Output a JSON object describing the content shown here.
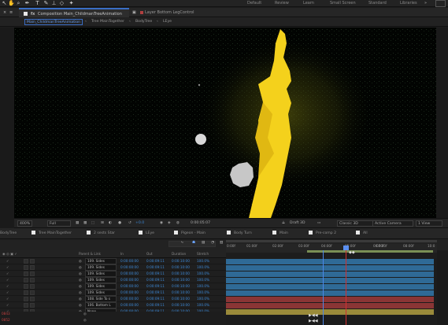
{
  "workspaces": [
    "Default",
    "Review",
    "Learn",
    "Small Screen",
    "Standard",
    "Libraries"
  ],
  "comp_panel": {
    "tab_label": "Composition Main_ChildmanTreeAnimation",
    "layer_tab_label": "Layer Bottom LegControl",
    "breadcrumbs": [
      "Main_ChildmanTreeAnimation",
      "Tree MainTogether",
      "BodyTree",
      "LEye"
    ]
  },
  "viewer_footer": {
    "zoom": "400%",
    "resolution": "Full",
    "exposure": "+0.0",
    "timecode": "0:00:05:07",
    "draft3d": "Draft 3D",
    "renderer": "Classic 3D",
    "camera": "Active Camera",
    "views": "1 View"
  },
  "timeline_tabs": [
    "BodyTree",
    "Tree MainTogether",
    "2 sests Star",
    "LEye",
    "Pigeon - Main",
    "Body Turn",
    "Main",
    "Pre-comp 2",
    "All"
  ],
  "layer_columns": [
    "Parent & Link",
    "In",
    "Out",
    "Duration",
    "Stretch"
  ],
  "ruler_ticks": [
    "0:00f",
    "01:00f",
    "02:00f",
    "03:00f",
    "04:00f",
    "05:00f",
    "06:00f",
    "07:00f",
    "08:00f",
    "09:00f",
    "10:0"
  ],
  "layers": [
    {
      "parent": "109. Sides",
      "in": "0:00:00:00",
      "out": "0:00:09:11",
      "duration": "0:00:10:00",
      "stretch": "100.0%",
      "bar": "#2f6a96"
    },
    {
      "parent": "109. Sides",
      "in": "0:00:00:00",
      "out": "0:00:09:11",
      "duration": "0:00:10:00",
      "stretch": "100.0%",
      "bar": "#2f6a96"
    },
    {
      "parent": "109. Sides",
      "in": "0:00:00:00",
      "out": "0:00:09:11",
      "duration": "0:00:10:00",
      "stretch": "100.0%",
      "bar": "#2f6a96"
    },
    {
      "parent": "109. Sides",
      "in": "0:00:00:00",
      "out": "0:00:09:11",
      "duration": "0:00:10:00",
      "stretch": "100.0%",
      "bar": "#2f6a96"
    },
    {
      "parent": "109. Sides",
      "in": "0:00:00:00",
      "out": "0:00:09:11",
      "duration": "0:00:10:00",
      "stretch": "100.0%",
      "bar": "#2f6a96"
    },
    {
      "parent": "109. Sides",
      "in": "0:00:00:00",
      "out": "0:00:09:11",
      "duration": "0:00:10:00",
      "stretch": "100.0%",
      "bar": "#2f6a96"
    },
    {
      "parent": "108. Side To s",
      "in": "0:00:00:00",
      "out": "0:00:09:11",
      "duration": "0:00:10:00",
      "stretch": "100.0%",
      "bar": "#8a3535"
    },
    {
      "parent": "106. Bottom L",
      "in": "0:00:00:00",
      "out": "0:00:09:11",
      "duration": "0:00:10:00",
      "stretch": "100.0%",
      "bar": "#8a3535"
    },
    {
      "parent": "None",
      "in": "0:00:00:00",
      "out": "0:00:09:11",
      "duration": "0:00:10:00",
      "stretch": "100.0%",
      "bar": "#9a8a3a"
    }
  ],
  "bottom_labels": [
    "0843",
    "0852"
  ],
  "colors": {
    "accent": "#3a6ec5",
    "cti": "#d03030",
    "flame": "#f5d21a"
  }
}
